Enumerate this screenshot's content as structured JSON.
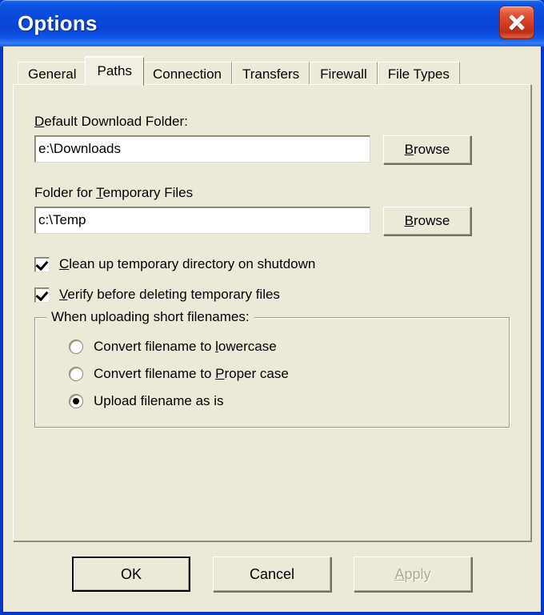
{
  "window": {
    "title": "Options",
    "close_icon": "close-icon",
    "accent_titlebar": "#0A46D8",
    "face_color": "#ECE9D8",
    "close_button_color": "#D33B1F"
  },
  "tabs": [
    {
      "label": "General",
      "active": false
    },
    {
      "label": "Paths",
      "active": true
    },
    {
      "label": "Connection",
      "active": false
    },
    {
      "label": "Transfers",
      "active": false
    },
    {
      "label": "Firewall",
      "active": false
    },
    {
      "label": "File Types",
      "active": false
    }
  ],
  "paths_page": {
    "download_folder": {
      "label_prefix": "",
      "label_accel": "D",
      "label_suffix": "efault Download Folder:",
      "value": "e:\\Downloads",
      "placeholder": "",
      "browse": {
        "accel": "B",
        "suffix": "rowse"
      }
    },
    "temp_folder": {
      "label_prefix": "Folder for ",
      "label_accel": "T",
      "label_suffix": "emporary Files",
      "value": "c:\\Temp",
      "placeholder": "",
      "browse": {
        "accel": "B",
        "suffix": "rowse"
      }
    },
    "checkboxes": [
      {
        "prefix": "",
        "accel": "C",
        "suffix": "lean up temporary directory on shutdown",
        "checked": true
      },
      {
        "prefix": "",
        "accel": "V",
        "suffix": "erify before deleting temporary files",
        "checked": true
      }
    ],
    "short_filenames_group": {
      "title": "When uploading short filenames:",
      "options": [
        {
          "prefix": "Convert filename to ",
          "accel": "l",
          "suffix": "owercase",
          "selected": false
        },
        {
          "prefix": "Convert filename to ",
          "accel": "P",
          "suffix": "roper case",
          "selected": false
        },
        {
          "prefix": "Upload filename as is",
          "accel": "",
          "suffix": "",
          "selected": true
        }
      ]
    }
  },
  "footer": {
    "ok": {
      "label": "OK",
      "default": true,
      "disabled": false
    },
    "cancel": {
      "label": "Cancel",
      "default": false,
      "disabled": false
    },
    "apply": {
      "prefix": "",
      "accel": "A",
      "suffix": "pply",
      "default": false,
      "disabled": true
    }
  }
}
